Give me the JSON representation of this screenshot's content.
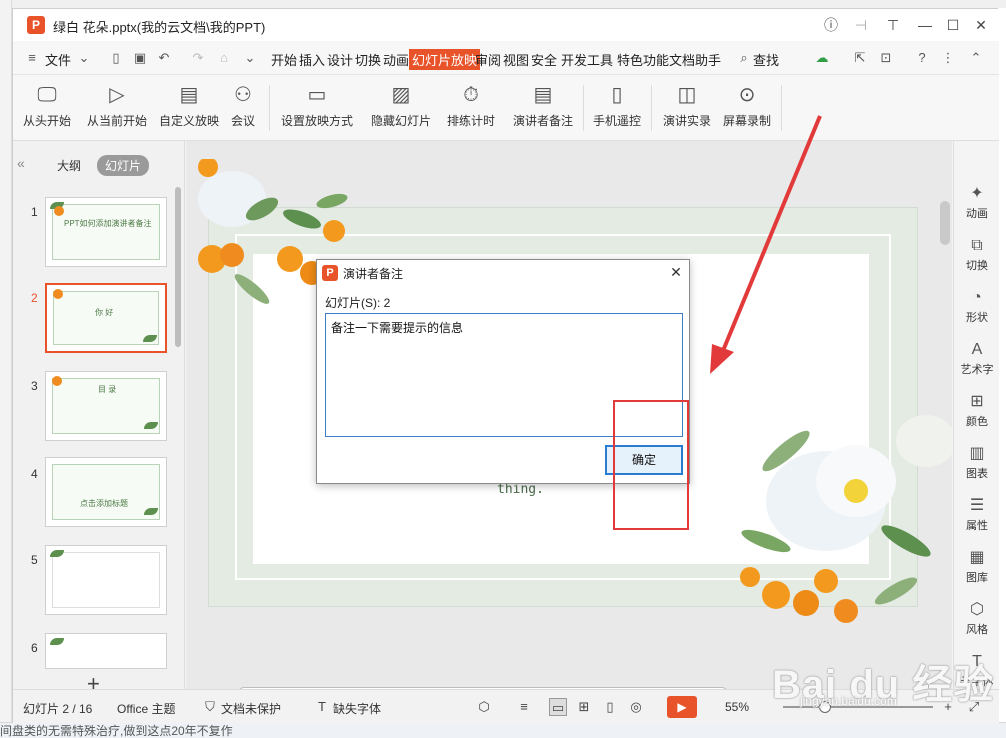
{
  "window": {
    "logo_letter": "P",
    "title": "绿白 花朵.pptx(我的云文档\\我的PPT)"
  },
  "menu": {
    "file_label": "文件",
    "tabs": [
      "开始",
      "插入",
      "设计",
      "切换",
      "动画",
      "幻灯片放映",
      "审阅",
      "视图",
      "安全",
      "开发工具",
      "特色功能",
      "文档助手"
    ],
    "active_tab": "幻灯片放映",
    "search_label": "查找"
  },
  "ribbon": {
    "buttons": [
      {
        "label": "从头开始",
        "icon": "monitor-play-icon"
      },
      {
        "label": "从当前开始",
        "icon": "play-circle-icon"
      },
      {
        "label": "自定义放映",
        "icon": "custom-show-icon"
      },
      {
        "label": "会议",
        "icon": "meeting-icon"
      },
      {
        "label": "设置放映方式",
        "icon": "settings-show-icon"
      },
      {
        "label": "隐藏幻灯片",
        "icon": "hide-slide-icon"
      },
      {
        "label": "排练计时",
        "icon": "timer-icon"
      },
      {
        "label": "演讲者备注",
        "icon": "speaker-notes-icon"
      },
      {
        "label": "手机遥控",
        "icon": "phone-icon"
      },
      {
        "label": "演讲实录",
        "icon": "record-camera-icon"
      },
      {
        "label": "屏幕录制",
        "icon": "screen-record-icon"
      }
    ]
  },
  "left_pane": {
    "tabs": [
      "大纲",
      "幻灯片"
    ],
    "active_tab": "幻灯片",
    "slides": [
      {
        "num": "1",
        "text": "PPT如何添加演讲者备注"
      },
      {
        "num": "2",
        "text": "你 好"
      },
      {
        "num": "3",
        "text": "目 录"
      },
      {
        "num": "4",
        "text": "点击添加标题"
      },
      {
        "num": "5",
        "text": ""
      },
      {
        "num": "6",
        "text": ""
      }
    ],
    "selected_slide": "2"
  },
  "slide": {
    "visible_text": "thing."
  },
  "right_bar": {
    "items": [
      {
        "label": "动画",
        "icon": "animation-icon"
      },
      {
        "label": "切换",
        "icon": "transition-icon"
      },
      {
        "label": "形状",
        "icon": "shape-icon"
      },
      {
        "label": "艺术字",
        "icon": "art-text-icon"
      },
      {
        "label": "颜色",
        "icon": "color-icon"
      },
      {
        "label": "图表",
        "icon": "chart-icon"
      },
      {
        "label": "属性",
        "icon": "properties-icon"
      },
      {
        "label": "图库",
        "icon": "gallery-icon"
      },
      {
        "label": "风格",
        "icon": "style-icon"
      },
      {
        "label": "云字体",
        "icon": "cloud-font-icon"
      }
    ]
  },
  "status": {
    "slide_counter": "幻灯片 2 / 16",
    "theme": "Office 主题",
    "protection": "文档未保护",
    "missing_font": "缺失字体",
    "zoom": "55%"
  },
  "dialog": {
    "title": "演讲者备注",
    "slide_label": "幻灯片(S): 2",
    "notes_value": "备注一下需要提示的信息",
    "ok_label": "确定"
  },
  "watermark": {
    "logo_text": "Bai du 经验",
    "url": "jingyan.baidu.com"
  },
  "desktop": {
    "bottom_text": "间盘类的无需特殊治疗,做到这点20年不复作"
  },
  "colors": {
    "accent": "#e8532a",
    "annotation_red": "#e23a3a",
    "dialog_button_border": "#2b7bd1"
  }
}
